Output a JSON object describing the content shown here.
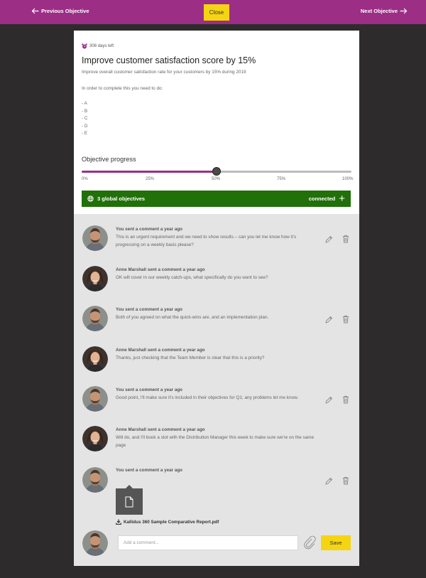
{
  "nav": {
    "previous_label": "Previous Objective",
    "close_label": "Close",
    "next_label": "Next Objective"
  },
  "objective": {
    "days_left": "308 days left",
    "title": "Improve customer satisfaction score by 15%",
    "description": "Improve overall customer satisfaction rate for your customers by 15% during 2019",
    "instructions": "In order to complete this you need to do:",
    "tasks": [
      "- A",
      "- B",
      "- C",
      "- D",
      "- E"
    ]
  },
  "progress": {
    "label": "Objective progress",
    "value_percent": 50,
    "ticks": [
      "0%",
      "25%",
      "50%",
      "75%",
      "100%"
    ]
  },
  "global": {
    "label": "3 global objectives",
    "status": "connected",
    "plus": "+"
  },
  "comments": [
    {
      "author": "You sent a comment a year ago",
      "text": "This is an urgent requirement and we need to show results – can you let me know how it's progressing on a weekly basis please?",
      "own": true
    },
    {
      "author": "Anne Marshall sent a comment a year ago",
      "text": "OK will cover in our weekly catch-ups, what specifically do you want to see?",
      "own": false
    },
    {
      "author": "You sent a comment a year ago",
      "text": "Both of you agreed on what the quick-wins are, and an implementation plan.",
      "own": true
    },
    {
      "author": "Anne Marshall sent a comment a year ago",
      "text": "Thanks, just checking that the Team Member is clear that this is a priority?",
      "own": false
    },
    {
      "author": "You sent a comment a year ago",
      "text": "Good point, I'll make sure it's included in their objectives for Q1; any problems let me know.",
      "own": true
    },
    {
      "author": "Anne Marshall sent a comment a year ago",
      "text": "Will do, and I'll book a slot with the Distribution Manager this week to make sure we're on the same page",
      "own": false
    },
    {
      "author": "You sent a comment a year ago",
      "text": "",
      "own": true,
      "attachment": "Kallidus 360 Sample Comparative Report.pdf"
    }
  ],
  "new_comment": {
    "placeholder": "Add a comment...",
    "save_label": "Save"
  },
  "colors": {
    "brand": "#9c2e86",
    "accent": "#f5d512",
    "success": "#217009"
  }
}
